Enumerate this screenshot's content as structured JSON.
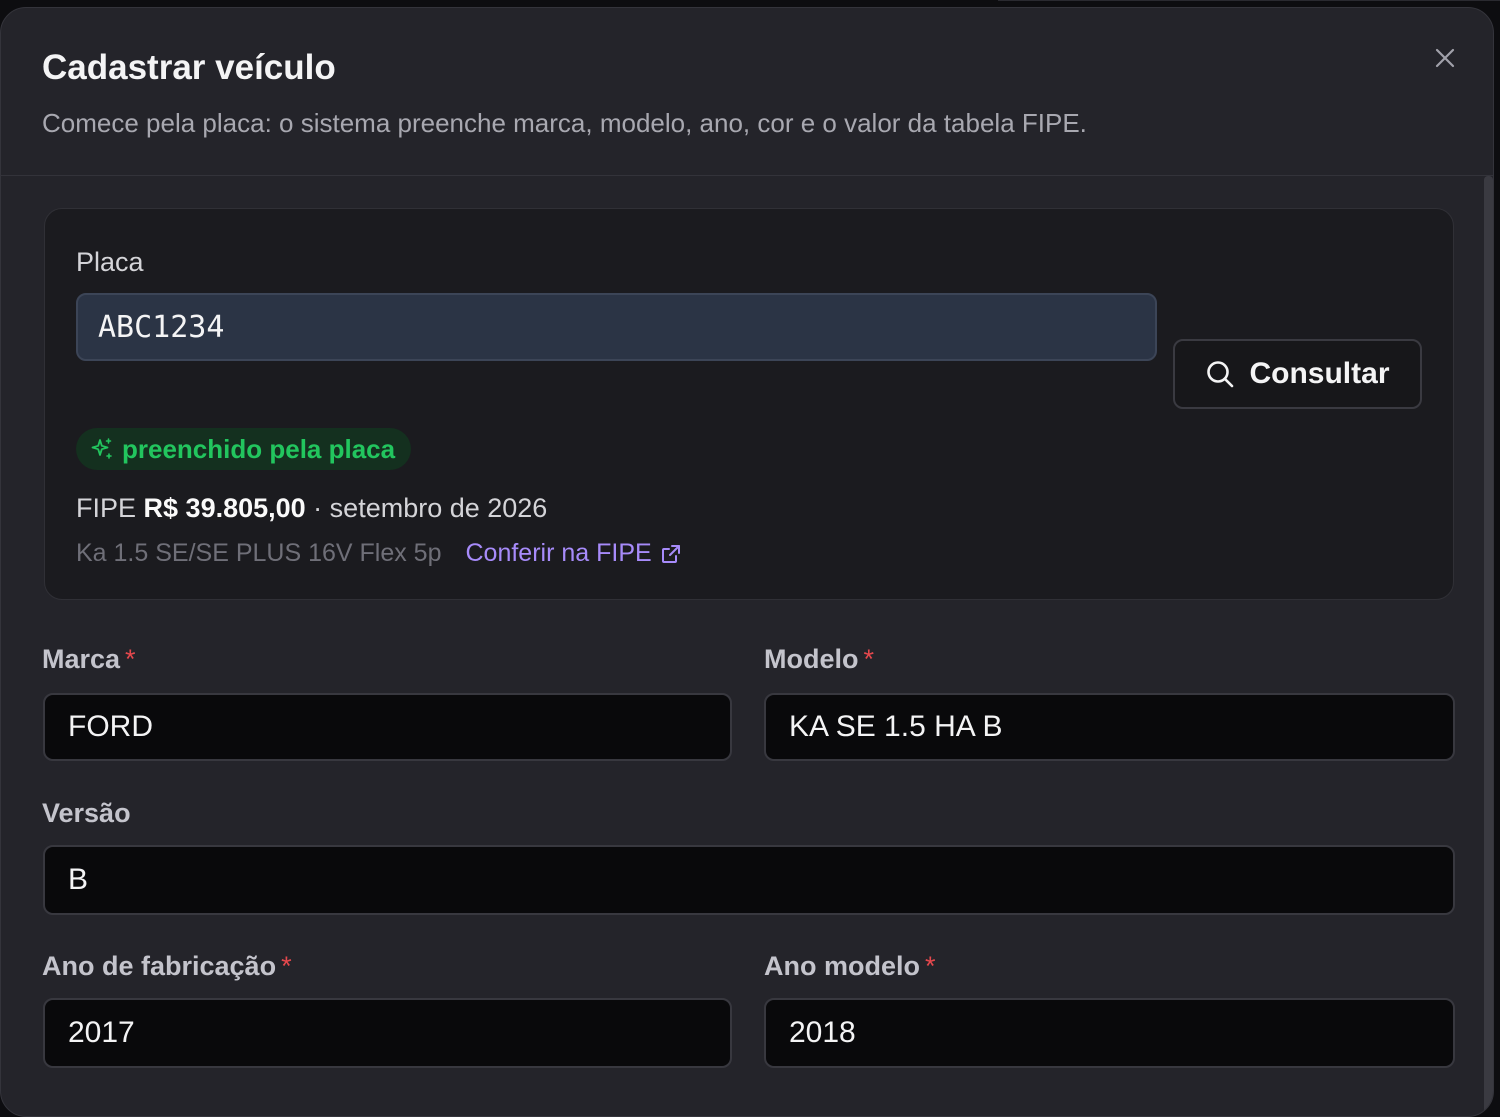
{
  "dialog": {
    "title": "Cadastrar veículo",
    "subtitle": "Comece pela placa: o sistema preenche marca, modelo, ano, cor e o valor da tabela FIPE.",
    "close_icon": "close-icon"
  },
  "plate": {
    "label": "Placa",
    "value": "ABC1234",
    "consult_label": "Consultar",
    "consult_icon": "search-icon"
  },
  "autofill_badge": {
    "icon": "sparkles-icon",
    "label": "preenchido pela placa",
    "color": "#22c55e"
  },
  "fipe": {
    "prefix": "FIPE",
    "price": "R$ 39.805,00",
    "separator": " · ",
    "reference": "setembro de 2026",
    "version": "Ka 1.5 SE/SE PLUS 16V Flex 5p",
    "link_label": "Conferir na FIPE",
    "link_icon": "external-link-icon",
    "link_color": "#a78bfa"
  },
  "fields": {
    "brand": {
      "label": "Marca",
      "required_mark": "*",
      "value": "FORD"
    },
    "model": {
      "label": "Modelo",
      "required_mark": "*",
      "value": "KA SE 1.5 HA B"
    },
    "version": {
      "label": "Versão",
      "value": "B"
    },
    "manufacture_year": {
      "label": "Ano de fabricação",
      "required_mark": "*",
      "value": "2017"
    },
    "model_year": {
      "label": "Ano modelo",
      "required_mark": "*",
      "value": "2018"
    }
  },
  "colors": {
    "accent_required": "#e5484d",
    "surface": "#24242a",
    "input_bg": "#09090b"
  }
}
